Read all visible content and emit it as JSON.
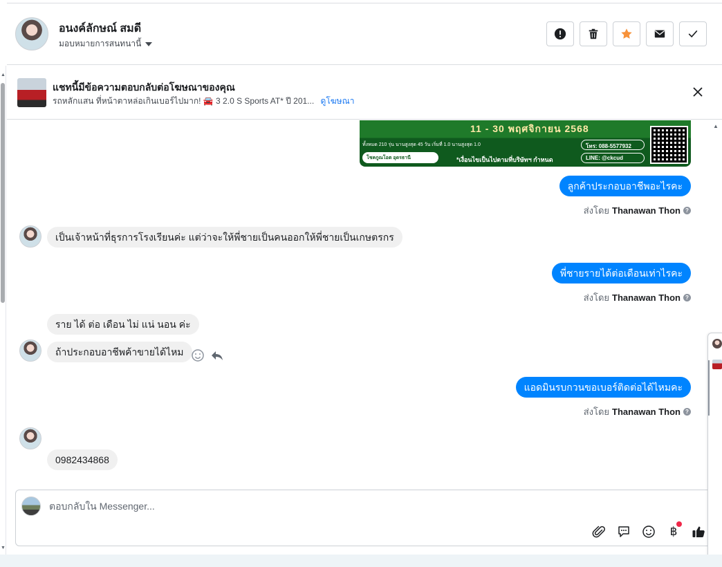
{
  "header": {
    "contact_name": "อนงค์ลักษณ์ สมดี",
    "assign_label": "มอบหมายการสนทนานี้",
    "actions": [
      "mark-spam",
      "delete",
      "star",
      "mark-unread",
      "mark-done"
    ]
  },
  "ad_banner": {
    "title": "แชทนี้มีข้อความตอบกลับต่อโฆษณาของคุณ",
    "subtitle": "รถหลักแสน ที่หน้าตาหล่อเกินเบอร์ไปมาก! 🚘 3 2.0 S Sports AT* ปี 201...",
    "link": "ดูโฆษณา"
  },
  "promo_image": {
    "date_line": "11 - 30 พฤศจิกายน 2568",
    "tel": "โทร: 088-5577932",
    "line_id": "LINE: @ckcud",
    "note": "*เงื่อนไขเป็นไปตามที่บริษัทฯ กำหนด",
    "promo_small": "ทั้งหมด 210 รุ่น   นานสูงสุด 45 วัน   เริ่มที่ 1.0   นานสูงสุด 1.0",
    "logo_text": "โชคกูณโอต อุดรธานี"
  },
  "messages": [
    {
      "id": "m1",
      "direction": "out",
      "text": "ลูกค้าประกอบอาชีพอะไรคะ",
      "sent_by_label": "ส่งโดย",
      "sent_by": "Thanawan Thon"
    },
    {
      "id": "m2",
      "direction": "in",
      "text": "เป็นเจ้าหน้าที่ธุรการโรงเรียนค่ะ แต่ว่าจะให้พี่ชายเป็นคนออกให้พี่ชายเป็นเกษตรกร"
    },
    {
      "id": "m3",
      "direction": "out",
      "text": "พี่ชายรายได้ต่อเดือนเท่าไรคะ",
      "sent_by_label": "ส่งโดย",
      "sent_by": "Thanawan Thon"
    },
    {
      "id": "m4",
      "direction": "in",
      "text": "ราย ได้ ต่อ เดือน ไม่ แน่ นอน ค่ะ"
    },
    {
      "id": "m5",
      "direction": "in",
      "text": "ถ้าประกอบอาชีพค้าขายได้ไหม"
    },
    {
      "id": "m6",
      "direction": "out",
      "text": "แอดมินรบกวนขอเบอร์ติดต่อได้ไหมคะ",
      "sent_by_label": "ส่งโดย",
      "sent_by": "Thanawan Thon"
    },
    {
      "id": "m7",
      "direction": "in",
      "text": "0982434868"
    }
  ],
  "composer": {
    "placeholder": "ตอบกลับใน Messenger...",
    "tools": [
      "attachment-icon",
      "saved-reply-icon",
      "emoji-icon",
      "payment-baht-icon",
      "like-icon"
    ],
    "baht_symbol": "฿"
  },
  "colors": {
    "outgoing_bubble": "#0084ff",
    "incoming_bubble": "#f0f0f0",
    "star_active": "#f7923a",
    "link": "#1877f2"
  }
}
